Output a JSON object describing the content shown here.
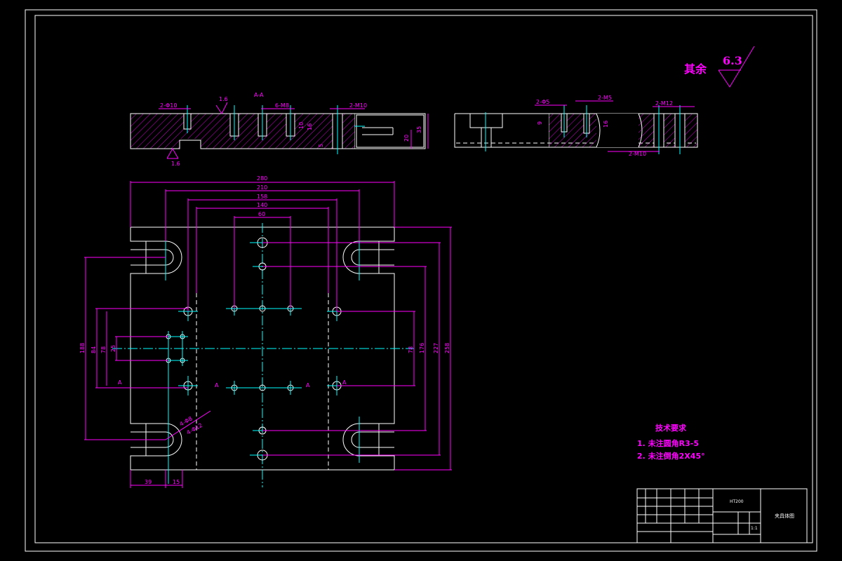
{
  "drawing": {
    "section_label": "A-A",
    "section_marks": [
      "A",
      "A",
      "A",
      "A"
    ],
    "roughness": {
      "remaining_label": "其余",
      "remaining_value": "6.3",
      "surface_values": [
        "1.6",
        "1.6"
      ]
    },
    "dimensions": {
      "widths": [
        "280",
        "210",
        "158",
        "140",
        "60"
      ],
      "left_heights": [
        "188",
        "84",
        "78",
        "25"
      ],
      "right_heights": [
        "78",
        "176",
        "227",
        "258"
      ],
      "bottom": [
        "39",
        "15"
      ],
      "slot_labels": [
        "4-Φ8",
        "4-Φ12"
      ],
      "section_front": [
        "2-Φ10",
        "6-M8",
        "2-M10",
        "35",
        "20",
        "10",
        "16",
        "5"
      ],
      "section_side": [
        "2-Φ5",
        "2-M5",
        "2-M12",
        "2-M10",
        "9",
        "16"
      ]
    },
    "tech_requirements": {
      "title": "技术要求",
      "items": [
        "1. 未注圆角R3-5",
        "2. 未注倒角2X45°"
      ]
    },
    "title_block": {
      "material": "HT200",
      "part_name": "夹具体图",
      "scale": "1:1"
    }
  }
}
